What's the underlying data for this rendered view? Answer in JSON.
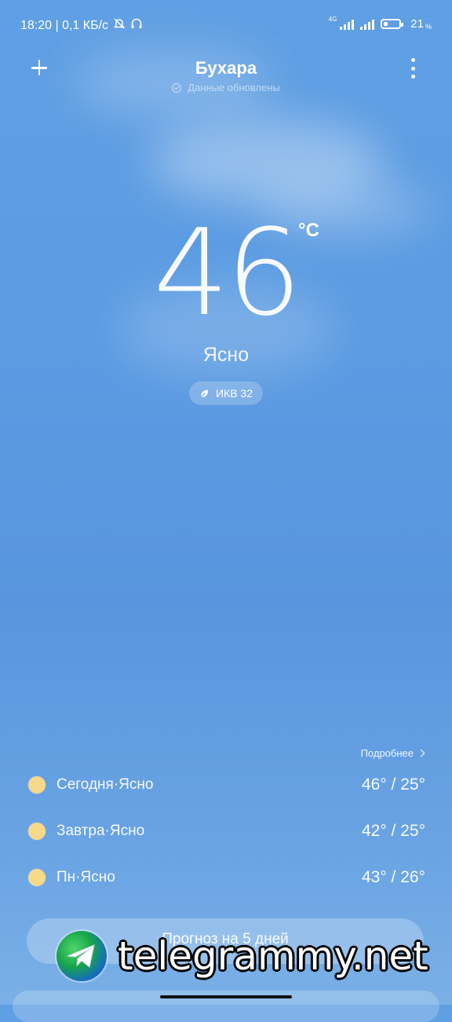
{
  "status_bar": {
    "time_info": "18:20 | 0,1 КБ/с",
    "network_type": "4G",
    "battery_percent": "21",
    "battery_unit": "%"
  },
  "header": {
    "city": "Бухара",
    "update_status": "Данные обновлены"
  },
  "current": {
    "temperature": "46",
    "unit": "°C",
    "condition": "Ясно",
    "aqi": "ИКВ 32"
  },
  "forecast": {
    "details_label": "Подробнее",
    "days": [
      {
        "label": "Сегодня·Ясно",
        "temps": "46° / 25°"
      },
      {
        "label": "Завтра·Ясно",
        "temps": "42° / 25°"
      },
      {
        "label": "Пн·Ясно",
        "temps": "43° / 26°"
      }
    ],
    "five_day_button": "Прогноз на 5 дней"
  },
  "watermark": {
    "text": "telegrammy.net"
  },
  "colors": {
    "sky_top": "#5f9fe3",
    "sky_bottom": "#7ab0e6",
    "sun": "#f8d98a"
  }
}
